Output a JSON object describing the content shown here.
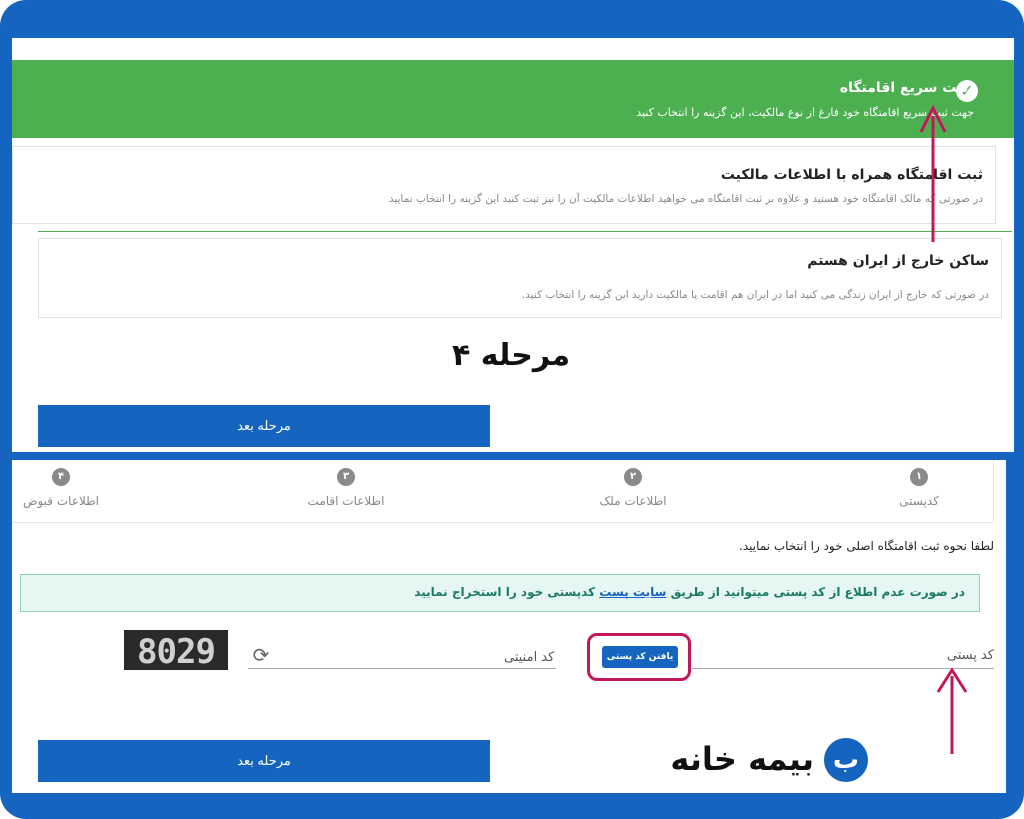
{
  "top": {
    "quick": {
      "title": "ثبت سریع اقامتگاه",
      "subtitle": "جهت ثبت سریع اقامتگاه خود فارغ از نوع مالکیت، این گزینه را انتخاب کنید"
    },
    "ownership": {
      "title": "ثبت اقامتگاه همراه با اطلاعات مالکیت",
      "desc": "در صورتی که مالک اقامتگاه خود هستید و علاوه بر ثبت اقامتگاه می خواهید اطلاعات مالکیت آن را نیز ثبت کنید این گزینه را انتخاب نمایید"
    },
    "abroad": {
      "title": "ساکن خارج از ایران هستم",
      "desc": "در صورتی که خارج از ایران زندگی می کنید اما در ایران هم اقامت یا مالکیت دارید این گزینه را انتخاب کنید."
    },
    "stage_label": "مرحله ۴",
    "next_label": "مرحله بعد"
  },
  "bottom": {
    "steps": [
      {
        "num": "۱",
        "label": "کدپستی"
      },
      {
        "num": "۲",
        "label": "اطلاعات ملک"
      },
      {
        "num": "۳",
        "label": "اطلاعات اقامت"
      },
      {
        "num": "۴",
        "label": "اطلاعات قبوض"
      }
    ],
    "instruction": "لطفا نحوه ثبت اقامتگاه اصلی خود را انتخاب نمایید.",
    "alert": {
      "before": "در صورت عدم اطلاع از کد پستی میتوانید از طریق",
      "link": "سایت پست",
      "after": "کدپستی خود را استخراج نمایید"
    },
    "postal_label": "کد پستی",
    "find_button": "یافتن کد پستی",
    "security_label": "کد امنیتی",
    "captcha_text": "8029",
    "next_label": "مرحله بعد",
    "logo_text": "بیمه خانه"
  },
  "colors": {
    "accent": "#1565c0",
    "success": "#4caf50",
    "highlight": "#c2185b"
  }
}
